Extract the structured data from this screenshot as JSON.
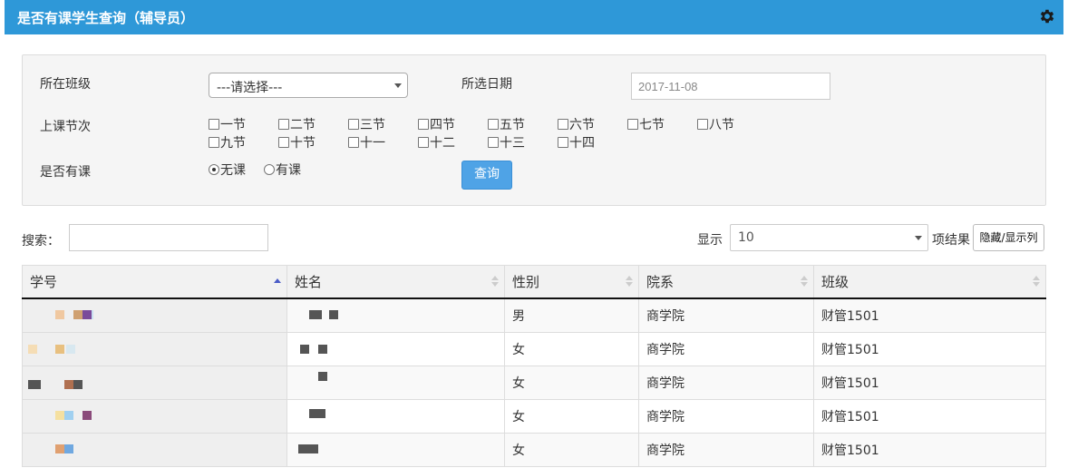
{
  "header": {
    "title": "是否有课学生查询（辅导员）",
    "gear_icon": "gear-icon"
  },
  "filters": {
    "class_label": "所在班级",
    "class_select_value": "---请选择---",
    "date_label": "所选日期",
    "date_value": "2017-11-08",
    "period_label": "上课节次",
    "periods": [
      "一节",
      "二节",
      "三节",
      "四节",
      "五节",
      "六节",
      "七节",
      "八节",
      "九节",
      "十节",
      "十一",
      "十二",
      "十三",
      "十四"
    ],
    "has_class_label": "是否有课",
    "radio_none": "无课",
    "radio_has": "有课",
    "query_button": "查询"
  },
  "toolbar": {
    "search_label": "搜索：",
    "show_label": "显示",
    "page_size": "10",
    "items_label": "项结果",
    "toggle_columns_button": "隐藏/显示列"
  },
  "table": {
    "columns": [
      "学号",
      "姓名",
      "性别",
      "院系",
      "班级"
    ],
    "rows": [
      {
        "gender": "男",
        "dept": "商学院",
        "class": "财管1501"
      },
      {
        "gender": "女",
        "dept": "商学院",
        "class": "财管1501"
      },
      {
        "gender": "女",
        "dept": "商学院",
        "class": "财管1501"
      },
      {
        "gender": "女",
        "dept": "商学院",
        "class": "财管1501"
      },
      {
        "gender": "女",
        "dept": "商学院",
        "class": "财管1501"
      }
    ]
  },
  "colors": {
    "title_bar": "#2e98d8",
    "query_button": "#4fa3e6",
    "sort_active": "#4a5cc7"
  }
}
